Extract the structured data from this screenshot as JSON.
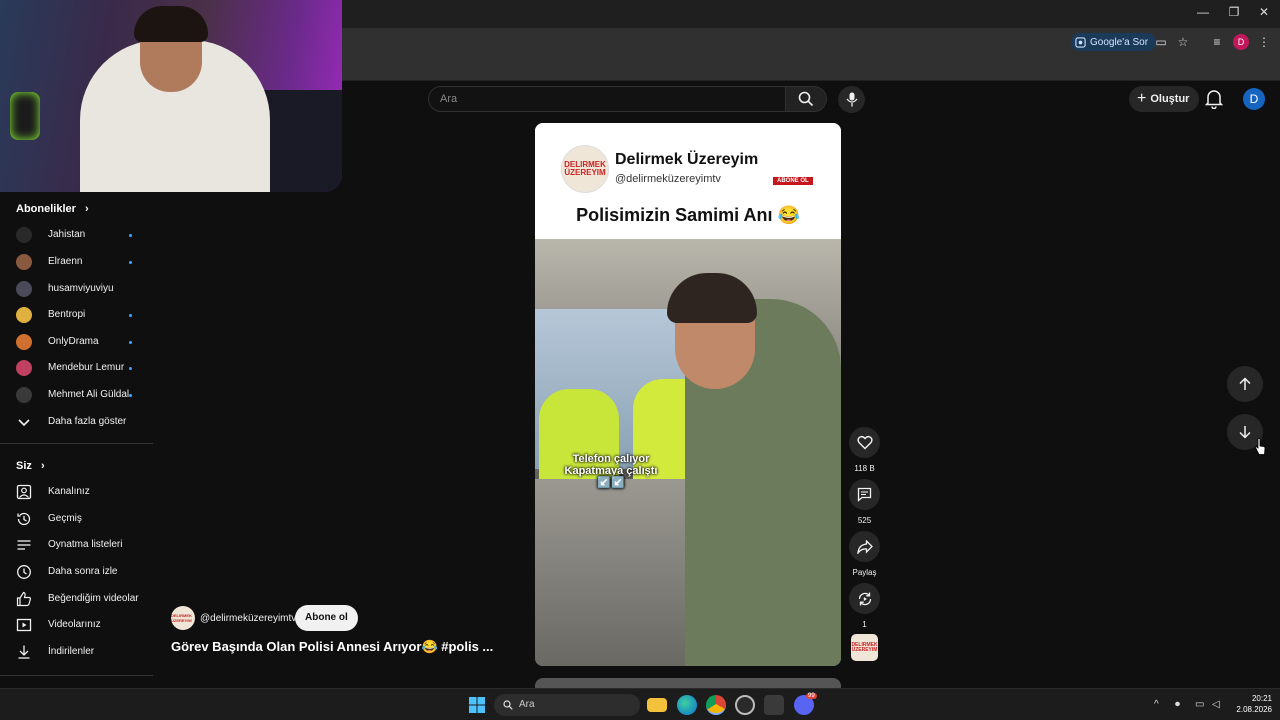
{
  "browser": {
    "google_search_label": "Google'a Sor",
    "profile_letter": "D",
    "window_controls": [
      "—",
      "❐",
      "✕"
    ]
  },
  "header": {
    "search_placeholder": "Ara",
    "create_label": "Oluştur",
    "avatar_letter": "D"
  },
  "sidebar": {
    "subscriptions_title": "Abonelikler",
    "subscriptions": [
      {
        "label": "Jahistan",
        "color": "#2a2a2a",
        "new": true
      },
      {
        "label": "Elraenn",
        "color": "#8a5a40",
        "new": true
      },
      {
        "label": "husamviyuviyu",
        "color": "#4a4a5a",
        "new": false
      },
      {
        "label": "Bentropi",
        "color": "#e0b040",
        "new": true
      },
      {
        "label": "OnlyDrama",
        "color": "#d07030",
        "new": true
      },
      {
        "label": "Mendebur Lemur",
        "color": "#c04060",
        "new": true
      },
      {
        "label": "Mehmet Ali Güldal",
        "color": "#3a3a3a",
        "new": true
      }
    ],
    "show_more": "Daha fazla göster",
    "you_title": "Siz",
    "you_items": [
      {
        "label": "Kanalınız",
        "icon": "channel-icon"
      },
      {
        "label": "Geçmiş",
        "icon": "history-icon"
      },
      {
        "label": "Oynatma listeleri",
        "icon": "playlists-icon"
      },
      {
        "label": "Daha sonra izle",
        "icon": "watch-later-icon"
      },
      {
        "label": "Beğendiğim videolar",
        "icon": "liked-icon"
      },
      {
        "label": "Videolarınız",
        "icon": "your-videos-icon"
      },
      {
        "label": "İndirilenler",
        "icon": "downloads-icon"
      }
    ]
  },
  "short": {
    "channel_name": "Delirmek Üzereyim",
    "channel_handle": "@delirmeküzereyimtv",
    "subscribe_badge": "ABONE OL",
    "logo_text": "DELIRMEK ÜZEREYIM",
    "title": "Polisimizin Samimi Anı 😂",
    "caption_line1": "Telefon çalıyor",
    "caption_line2": "Kapatmaya çalıştı",
    "caption_emoji": "↙️↙️"
  },
  "actions": {
    "likes": "118 B",
    "comments": "525",
    "share": "Paylaş",
    "remix": "1"
  },
  "meta": {
    "handle": "@delirmeküzereyimtv",
    "subscribe": "Abone ol",
    "title": "Görev Başında Olan Polisi Annesi Arıyor😂 #polis ..."
  },
  "taskbar": {
    "search": "Ara",
    "time": "20:21",
    "date": "2.08.2026",
    "discord_badge": "99"
  },
  "colors": {
    "accent_blue": "#3ea6ff",
    "subscribe_red": "#c4161c",
    "background": "#0f0f0f"
  }
}
